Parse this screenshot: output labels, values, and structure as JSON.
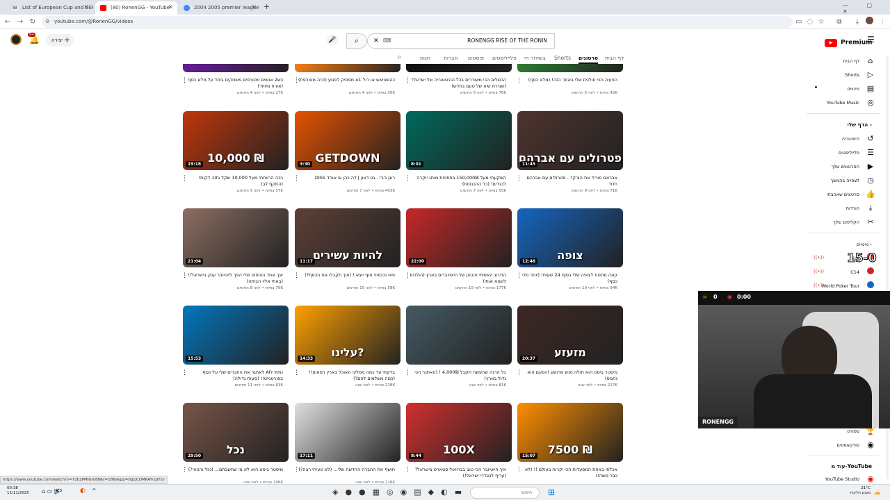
{
  "browser": {
    "tabs": [
      {
        "title": "List of European Cup and UEFA",
        "favicon": "W",
        "color": "#666666"
      },
      {
        "title": "(80) RonenGG - YouTube",
        "favicon": "yt",
        "color": "#ff0000"
      },
      {
        "title": "2004 2005 premier league table",
        "favicon": "G",
        "color": "#4285f4"
      }
    ],
    "url": "youtube.com/@RonenGG/videos",
    "status_url": "https://www.youtube.com/watch?v=72b2PMIGm88&t=186s&pp=0gcJCOMKAYcqIYzv"
  },
  "youtube": {
    "premium_label": "Premium",
    "search_text": "RONENGG RISE OF THE RONIN",
    "create_label": "יצירה",
    "notif_badge": "9+",
    "channel_tabs": [
      "דף הבית",
      "סרטונים",
      "Shorts",
      "בשידור חי",
      "פלייליסטים",
      "פוסטים",
      "חברות",
      "חנות"
    ]
  },
  "sidebar": {
    "top": [
      {
        "label": "דף הבית",
        "icon": "home-icon",
        "glyph": "⌂"
      },
      {
        "label": "Shorts",
        "icon": "shorts-icon",
        "glyph": "▷"
      },
      {
        "label": "מינויים",
        "icon": "subscriptions-icon",
        "glyph": "▤"
      },
      {
        "label": "YouTube Music",
        "icon": "music-icon",
        "glyph": "◎"
      }
    ],
    "you_heading": "הדף שלי",
    "you": [
      {
        "label": "היסטוריה",
        "icon": "history-icon",
        "glyph": "↺"
      },
      {
        "label": "פלייליסטים",
        "icon": "playlists-icon",
        "glyph": "☰"
      },
      {
        "label": "הסרטונים שלך",
        "icon": "your-videos-icon",
        "glyph": "▶"
      },
      {
        "label": "לצפייה בהמשך",
        "icon": "watch-later-icon",
        "glyph": "◷"
      },
      {
        "label": "סרטונים שאהבתי",
        "icon": "liked-icon",
        "glyph": "👍"
      },
      {
        "label": "הורדות",
        "icon": "downloads-icon",
        "glyph": "⤓"
      },
      {
        "label": "הקליפים שלך",
        "icon": "clips-icon",
        "glyph": "✂"
      }
    ],
    "subs_heading": "מינויים",
    "subs": [
      {
        "label": "Nick",
        "color": "#e53935"
      },
      {
        "label": "C14",
        "color": "#c62828"
      },
      {
        "label": "World Poker Tour",
        "color": "#1565c0"
      }
    ],
    "bottom": [
      {
        "label": "ספורט",
        "icon": "trophy-icon",
        "glyph": "🏆"
      },
      {
        "label": "פודקאסטים",
        "icon": "podcast-icon",
        "glyph": "◉"
      }
    ],
    "more_heading": "עוד מ-YouTube",
    "studio": {
      "label": "YouTube Studio",
      "icon": "studio-icon",
      "glyph": "◉"
    }
  },
  "videos": [
    {
      "title": "הפעיה הכי חולנית שלי באתר הזה! (מלא כסף)",
      "meta": "42K צפיות • לפני 5 חודשים",
      "dur": "",
      "bg": "#2e7d32",
      "ovl": ""
    },
    {
      "title": "הכשלים הכי משוררים בכל ההיסטוריה של ישראל! (שבירת שיא של טעם בחדש)",
      "meta": "76K צפיות • לפני 5 חודשים",
      "dur": "",
      "bg": "#111111",
      "ovl": ""
    },
    {
      "title": "כהשטיאש או רול 1א מפסיק לפגוע (זכיה מטורפת)",
      "meta": "30K צפיות • לפני 4 חודשים",
      "dur": "",
      "bg": "#f57f17",
      "ovl": ""
    },
    {
      "title": "כש2 אנשים מטורפים משחקים ביחד על מלא כסף (אורח מיוחד)",
      "meta": "27K צפיות • לפני 4 חודשים",
      "dur": "",
      "bg": "#6a1b9a",
      "ovl": ""
    },
    {
      "title": "אבראם מוריד את הצ'ק? - פטרולים עם אברהם חדו!",
      "meta": "71K צפיות • לפני 9 חודשים",
      "dur": "11:45",
      "bg": "#4e342e",
      "ovl": "פטרולים עם אברהם"
    },
    {
      "title": "השקעתי מעל 150,000₪ בפתיחת מותג יוקרה לבגדים! (כל ההכנסות)",
      "meta": "55K צפיות • לפני 7 חודשים",
      "dur": "8:01",
      "bg": "#00695c",
      "ovl": ""
    },
    {
      "title": "רונן ג'ג'י - גט דאון | דה כהן & אוהד DISS",
      "meta": "403K צפיות • לפני 7 חודשים",
      "dur": "3:30",
      "bg": "#e65100",
      "ovl": "GETDOWN"
    },
    {
      "title": "ככה הרווחתי מעל 10,000 שקל ב10 דקות! (התקף לב)",
      "meta": "57K צפיות • לפני 5 חודשים",
      "dur": "19:18",
      "bg": "#bf360c",
      "ovl": "10,000 ₪"
    },
    {
      "title": "קונה מתנות לצופה שלי בסוף 24 שעות! (יותר מדי כסף)",
      "meta": "94K צפיות • לפני 10 חודשים",
      "dur": "12:46",
      "bg": "#1565c0",
      "ovl": "צופה"
    },
    {
      "title": "הדירוג האמיתי והכנון של היוטיוברים בארץ (הולכים לשנוא אותי)",
      "meta": "177K צפיות • לפני 10 חודשים",
      "dur": "22:00",
      "bg": "#c62828",
      "ovl": ""
    },
    {
      "title": "פאי נכנסתי סוף יוצא ! (איך תקבלו את הכסף?)",
      "meta": "58K צפיות • לפני 10 חודשים",
      "dur": "11:17",
      "bg": "#5d4037",
      "ovl": "להיות עשירים"
    },
    {
      "title": "איך אחד הצופים שלי הפך ליוטיובר ענק בישראל!! (באתי אליו הביתה)",
      "meta": "70K צפיות • לפני 8 חודשים",
      "dur": "21:04",
      "bg": "#8d6e63",
      "ovl": ""
    },
    {
      "title": "מיסטר ביסט הוא חולה נפש מרושע (הפעם הוא נחמס)",
      "meta": "217K צפיות • לפני שנה",
      "dur": "20:37",
      "bg": "#3e2723",
      "ovl": "מזעזע"
    },
    {
      "title": "כל הרגה שהעשה תקבל 4,000₪ ! (האתגר הכי גדול בארץ)",
      "meta": "81K צפיות • לפני שנה",
      "dur": "",
      "bg": "#455a64",
      "ovl": ""
    },
    {
      "title": "בדקתי עד כמה מפליגי האוכל בארץ רמאים!! (כמה משלמים להם?)",
      "meta": "228K צפיות • לפני שנה",
      "dur": "14:33",
      "bg": "#ffa000",
      "ovl": "עלינו?"
    },
    {
      "title": "נתתי לAI לאתגר את החברים שלי על כסף בפורטנייט!! (סעות גדולה)",
      "meta": "63K צפיות • לפני 11 חודשים",
      "dur": "15:53",
      "bg": "#0277bd",
      "ovl": ""
    },
    {
      "title": "אכלתי באחת המסעדות הכי יקרות בעולם !! (לא כבר משה!)",
      "meta": "",
      "dur": "15:07",
      "bg": "#ff8f00",
      "ovl": "7500 ₪"
    },
    {
      "title": "איך היוטיובר הכי טוב בברואול סטארס בישראל? (עריף לנוגדרי ישראל!)",
      "meta": "",
      "dur": "8:44",
      "bg": "#d32f2f",
      "ovl": "100X"
    },
    {
      "title": "חושף את החברה החדשה שלי... (לא טעיתי רבה?)",
      "meta": "218K צפיות • לפני שנה",
      "dur": "17:11",
      "bg": "#e0e0e0",
      "ovl": ""
    },
    {
      "title": "מיסטר ביסט הוא לא מי שחשבתם... (נכל ורמאי?)",
      "meta": "206K צפיות • לפני שנה",
      "dur": "29:50",
      "bg": "#795548",
      "ovl": "נכל"
    }
  ],
  "overlay": {
    "score_left": "0",
    "score_right": "0:00",
    "streamer_tag": "RONENGG",
    "score_badge": "15-0"
  },
  "taskbar": {
    "time": "00:38",
    "date": "11/11/2025",
    "lang": "HE3",
    "temp": "21°C",
    "weather": "מעונן חלקית",
    "search_placeholder": "חיפוש"
  }
}
